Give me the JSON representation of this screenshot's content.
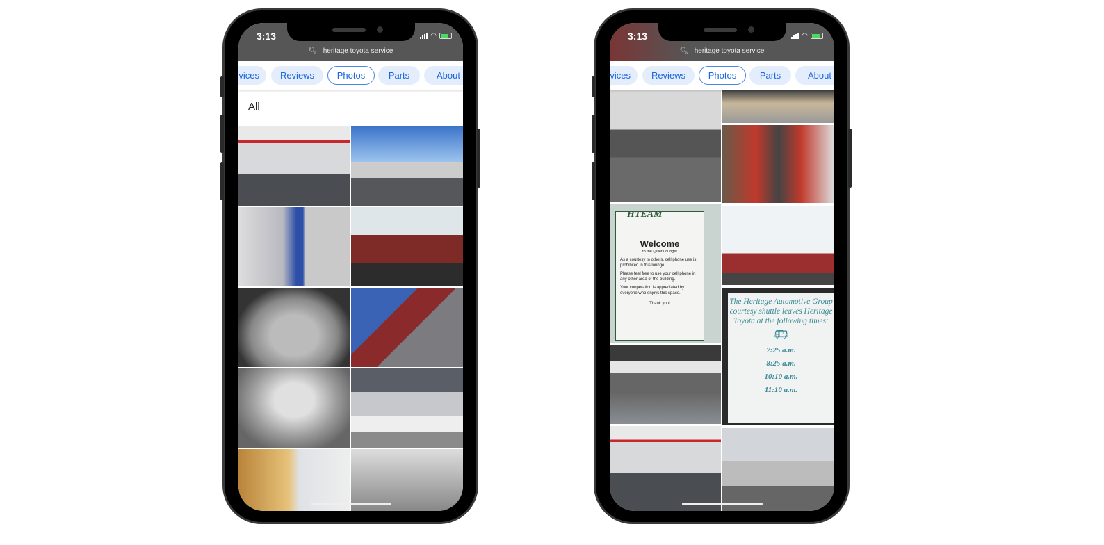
{
  "phones": [
    {
      "status": {
        "time": "3:13"
      },
      "search_query": "heritage toyota service",
      "tabs": [
        {
          "label": "vices"
        },
        {
          "label": "Reviews"
        },
        {
          "label": "Photos",
          "selected": true
        },
        {
          "label": "Parts"
        },
        {
          "label": "About"
        }
      ],
      "section_heading": "All"
    },
    {
      "status": {
        "time": "3:13"
      },
      "search_query": "heritage toyota service",
      "tabs": [
        {
          "label": "vices"
        },
        {
          "label": "Reviews"
        },
        {
          "label": "Photos",
          "selected": true
        },
        {
          "label": "Parts"
        },
        {
          "label": "About"
        }
      ]
    }
  ],
  "signs": {
    "lounge": {
      "logo": "HTEAM",
      "title": "Welcome",
      "subtitle": "to the Quiet Lounge!",
      "p1": "As a courtesy to others, cell phone use is prohibited in this lounge.",
      "p2": "Please feel free to use your cell phone in any other area of the building.",
      "p3": "Your cooperation is appreciated by everyone who enjoys this space.",
      "p4": "Thank you!"
    },
    "shuttle": {
      "text": "The Heritage Automotive Group courtesy shuttle leaves Heritage Toyota at the following times:",
      "times": [
        "7:25 a.m.",
        "8:25 a.m.",
        "10:10 a.m.",
        "11:10 a.m."
      ]
    }
  },
  "colors": {
    "accent": "#1a66e0",
    "chip_bg": "#e4edfb",
    "status_bar": "#565656"
  }
}
